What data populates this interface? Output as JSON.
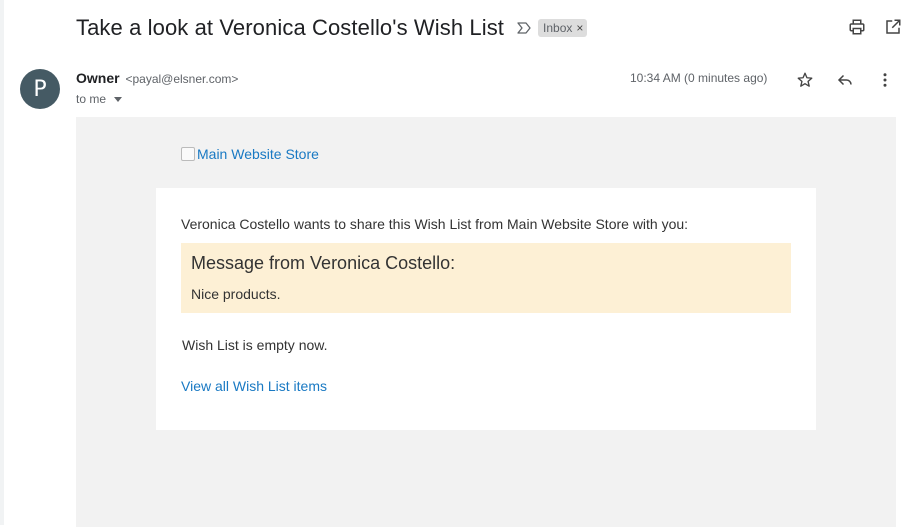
{
  "email": {
    "subject": "Take a look at Veronica Costello's Wish List",
    "label": "Inbox",
    "label_remove": "×",
    "sender": {
      "avatar_letter": "P",
      "name": "Owner",
      "email": "<payal@elsner.com>",
      "to": "to me"
    },
    "timestamp": "10:34 AM (0 minutes ago)"
  },
  "body": {
    "logo_alt": "Main Website Store",
    "intro": "Veronica Costello wants to share this Wish List from Main Website Store with you:",
    "message_title": "Message from Veronica Costello:",
    "message_text": "Nice products.",
    "empty_note": "Wish List is empty now.",
    "view_link": "View all Wish List items"
  },
  "icons": {
    "importance": "importance-marker-icon",
    "print": "print-icon",
    "open_new_window": "open-in-new-window-icon",
    "star": "star-icon",
    "reply": "reply-icon",
    "more": "more-vertical-icon"
  },
  "colors": {
    "avatar": "#455a64",
    "link": "#1979c3",
    "message_box": "#fdf0d5",
    "body_bg": "#f2f2f2",
    "label_chip": "#dddddd"
  }
}
